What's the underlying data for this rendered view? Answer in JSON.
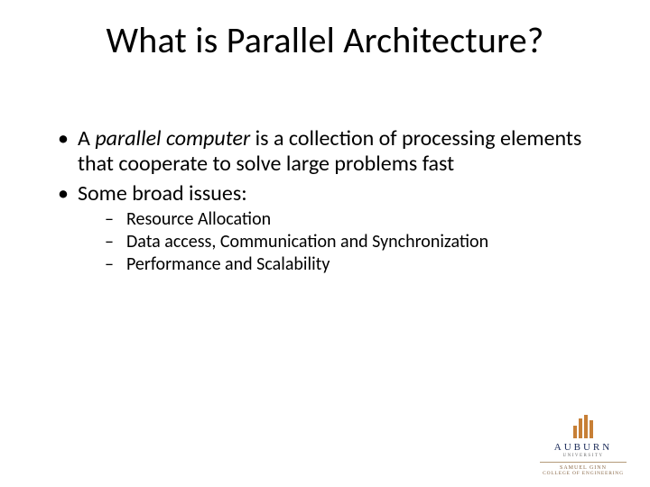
{
  "title": "What is Parallel Architecture?",
  "bullets": {
    "b1": {
      "prefix": "A ",
      "italic": "parallel computer",
      "rest": " is a collection of processing elements that cooperate  to solve large problems fast"
    },
    "b2": "Some broad issues:",
    "sub": {
      "s1": "Resource Allocation",
      "s2": "Data access, Communication and Synchronization",
      "s3": "Performance and Scalability"
    }
  },
  "logo": {
    "name": "AUBURN",
    "univ": "UNIVERSITY",
    "sub1": "SAMUEL GINN",
    "sub2": "COLLEGE OF ENGINEERING"
  }
}
